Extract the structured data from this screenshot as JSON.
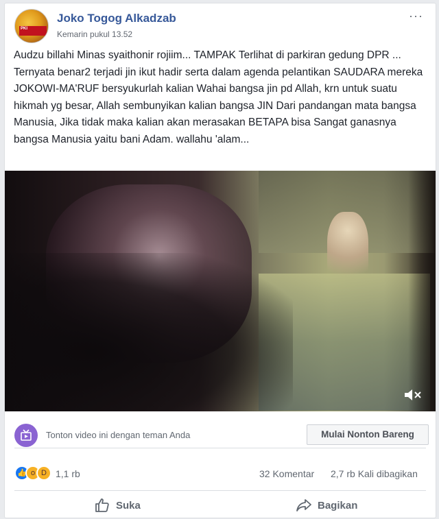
{
  "post": {
    "author": "Joko Togog Alkadzab",
    "timestamp": "Kemarin pukul 13.52",
    "more_icon": "more-options-icon",
    "avatar_text": "PKI",
    "text": "Audzu billahi Minas syaithonir rojiim... TAMPAK Terlihat di parkiran gedung DPR ... Ternyata benar2 terjadi jin ikut hadir serta dalam agenda pelantikan SAUDARA mereka JOKOWI-MA'RUF bersyukurlah kalian Wahai bangsa jin pd Allah, krn untuk suatu hikmah yg besar, Allah sembunyikan kalian bangsa JIN Dari pandangan mata bangsa Manusia, Jika tidak maka kalian akan merasakan BETAPA bisa Sangat ganasnya bangsa Manusia yaitu bani Adam. wallahu 'alam..."
  },
  "video": {
    "mute_icon": "speaker-muted-icon"
  },
  "watch_party": {
    "text": "Tonton video ini dengan teman Anda",
    "button": "Mulai Nonton Bareng",
    "icon": "watch-party-icon",
    "icon_color": "#8a63d2"
  },
  "stats": {
    "reactions": [
      "like-icon",
      "wow-icon",
      "haha-icon"
    ],
    "reaction_count": "1,1 rb",
    "comments": "32 Komentar",
    "shares": "2,7 rb Kali dibagikan"
  },
  "actions": {
    "like": "Suka",
    "share": "Bagikan"
  },
  "colors": {
    "name_link": "#365899",
    "like_blue": "#1877f2",
    "emoji_yellow": "#f7b125"
  }
}
